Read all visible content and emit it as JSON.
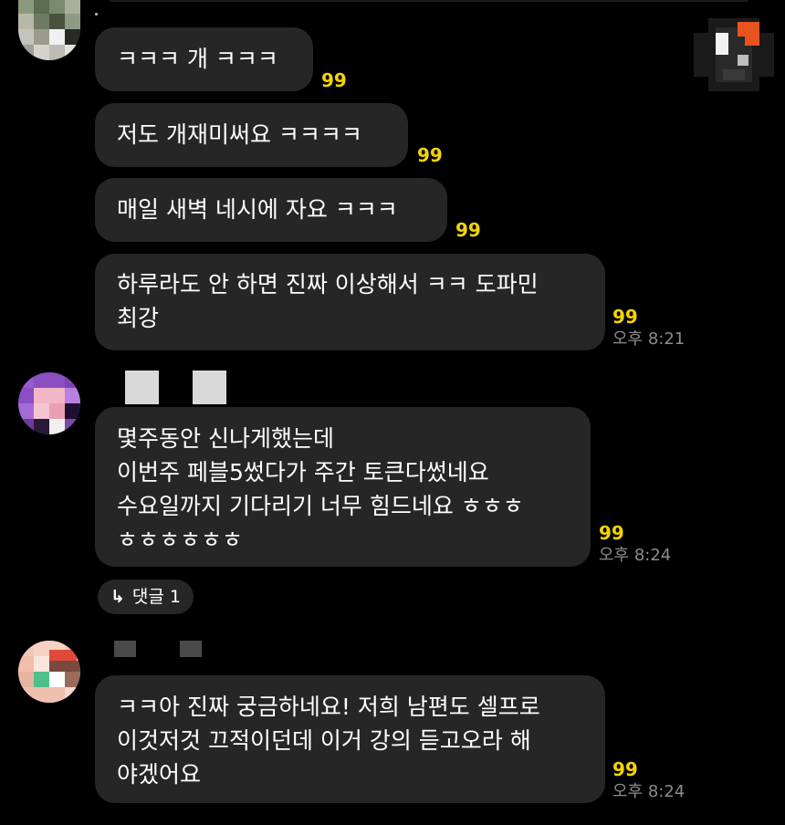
{
  "messages": [
    {
      "text": "ㅋㅋㅋ 개 ㅋㅋㅋ",
      "unread": "99"
    },
    {
      "text": "저도 개재미써요 ㅋㅋㅋㅋ",
      "unread": "99"
    },
    {
      "text": "매일 새벽 네시에 자요 ㅋㅋㅋ",
      "unread": "99"
    },
    {
      "lines": [
        "하루라도 안 하면 진짜 이상해서 ㅋㅋ 도파민",
        "최강"
      ],
      "unread": "99",
      "time": "오후 8:21"
    },
    {
      "lines": [
        "몇주동안 신나게했는데",
        "이번주 페블5썼다가 주간 토큰다썼네요",
        "수요일까지 기다리기 너무 힘드네요 ㅎㅎㅎ",
        "ㅎㅎㅎㅎㅎㅎ"
      ],
      "unread": "99",
      "time": "오후 8:24"
    },
    {
      "lines": [
        "ㅋㅋ아 진짜 궁금하네요! 저희 남편도 셀프로",
        "이것저것 끄적이던데 이거 강의 듣고오라 해",
        "야겠어요"
      ],
      "unread": "99",
      "time": "오후 8:24"
    }
  ],
  "reply_chip": {
    "arrow": "↳",
    "label": "댓글 1"
  },
  "colors": {
    "bubble": "#262626",
    "unread": "#f5d400",
    "time": "#8c8c8c",
    "background": "#000000"
  }
}
